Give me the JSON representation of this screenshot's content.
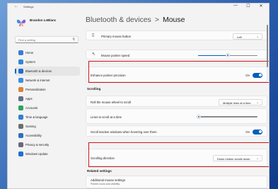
{
  "window": {
    "title": "Settings",
    "back_glyph": "←",
    "minimize_glyph": "—",
    "maximize_glyph": "☐",
    "close_glyph": "✕"
  },
  "user": {
    "name": "Brandon LeBlanc",
    "email": "",
    "avatar": "butterfly-avatar"
  },
  "search": {
    "placeholder": "Find a setting",
    "icon": "search-icon"
  },
  "nav": [
    {
      "label": "Home",
      "icon": "home-icon",
      "color": "#3a7bd5",
      "active": false
    },
    {
      "label": "System",
      "icon": "system-icon",
      "color": "#2f86d6",
      "active": false
    },
    {
      "label": "Bluetooth & devices",
      "icon": "bluetooth-icon",
      "color": "#1b6fd0",
      "active": true
    },
    {
      "label": "Network & internet",
      "icon": "network-icon",
      "color": "#3a8ee0",
      "active": false
    },
    {
      "label": "Personalization",
      "icon": "personalization-icon",
      "color": "#d8843a",
      "active": false
    },
    {
      "label": "Apps",
      "icon": "apps-icon",
      "color": "#5f6e8a",
      "active": false
    },
    {
      "label": "Accounts",
      "icon": "accounts-icon",
      "color": "#2fa35b",
      "active": false
    },
    {
      "label": "Time & language",
      "icon": "time-language-icon",
      "color": "#2f7fd6",
      "active": false
    },
    {
      "label": "Gaming",
      "icon": "gaming-icon",
      "color": "#6d6d6d",
      "active": false
    },
    {
      "label": "Accessibility",
      "icon": "accessibility-icon",
      "color": "#2d6fc0",
      "active": false
    },
    {
      "label": "Privacy & security",
      "icon": "shield-icon",
      "color": "#6a6a78",
      "active": false
    },
    {
      "label": "Windows Update",
      "icon": "windows-update-icon",
      "color": "#1e6fd0",
      "active": false
    }
  ],
  "page": {
    "crumb": "Bluetooth & devices",
    "chevron": ">",
    "title": "Mouse"
  },
  "settings": {
    "primary_button": {
      "label": "Primary mouse button",
      "value": "Left"
    },
    "pointer_speed": {
      "label": "Mouse pointer speed",
      "level": 0.5
    },
    "enhance_precision": {
      "label": "Enhance pointer precision",
      "state": "On",
      "on": true
    },
    "scrolling_header": "Scrolling",
    "roll_wheel": {
      "label": "Roll the mouse wheel to scroll",
      "value": "Multiple lines at a time"
    },
    "lines_to_scroll": {
      "label": "Lines to scroll at a time",
      "level": 0.03
    },
    "scroll_inactive": {
      "label": "Scroll inactive windows when hovering over them",
      "state": "On",
      "on": true
    },
    "scrolling_direction": {
      "label": "Scrolling direction",
      "value": "Down motion scrolls down"
    },
    "related_header": "Related settings",
    "additional": {
      "label": "Additional mouse settings",
      "sub": "Pointer icons and visibility"
    }
  },
  "colors": {
    "accent": "#005fb8",
    "highlight_box": "#c8161d"
  },
  "dropdown_chevron": "⌄"
}
